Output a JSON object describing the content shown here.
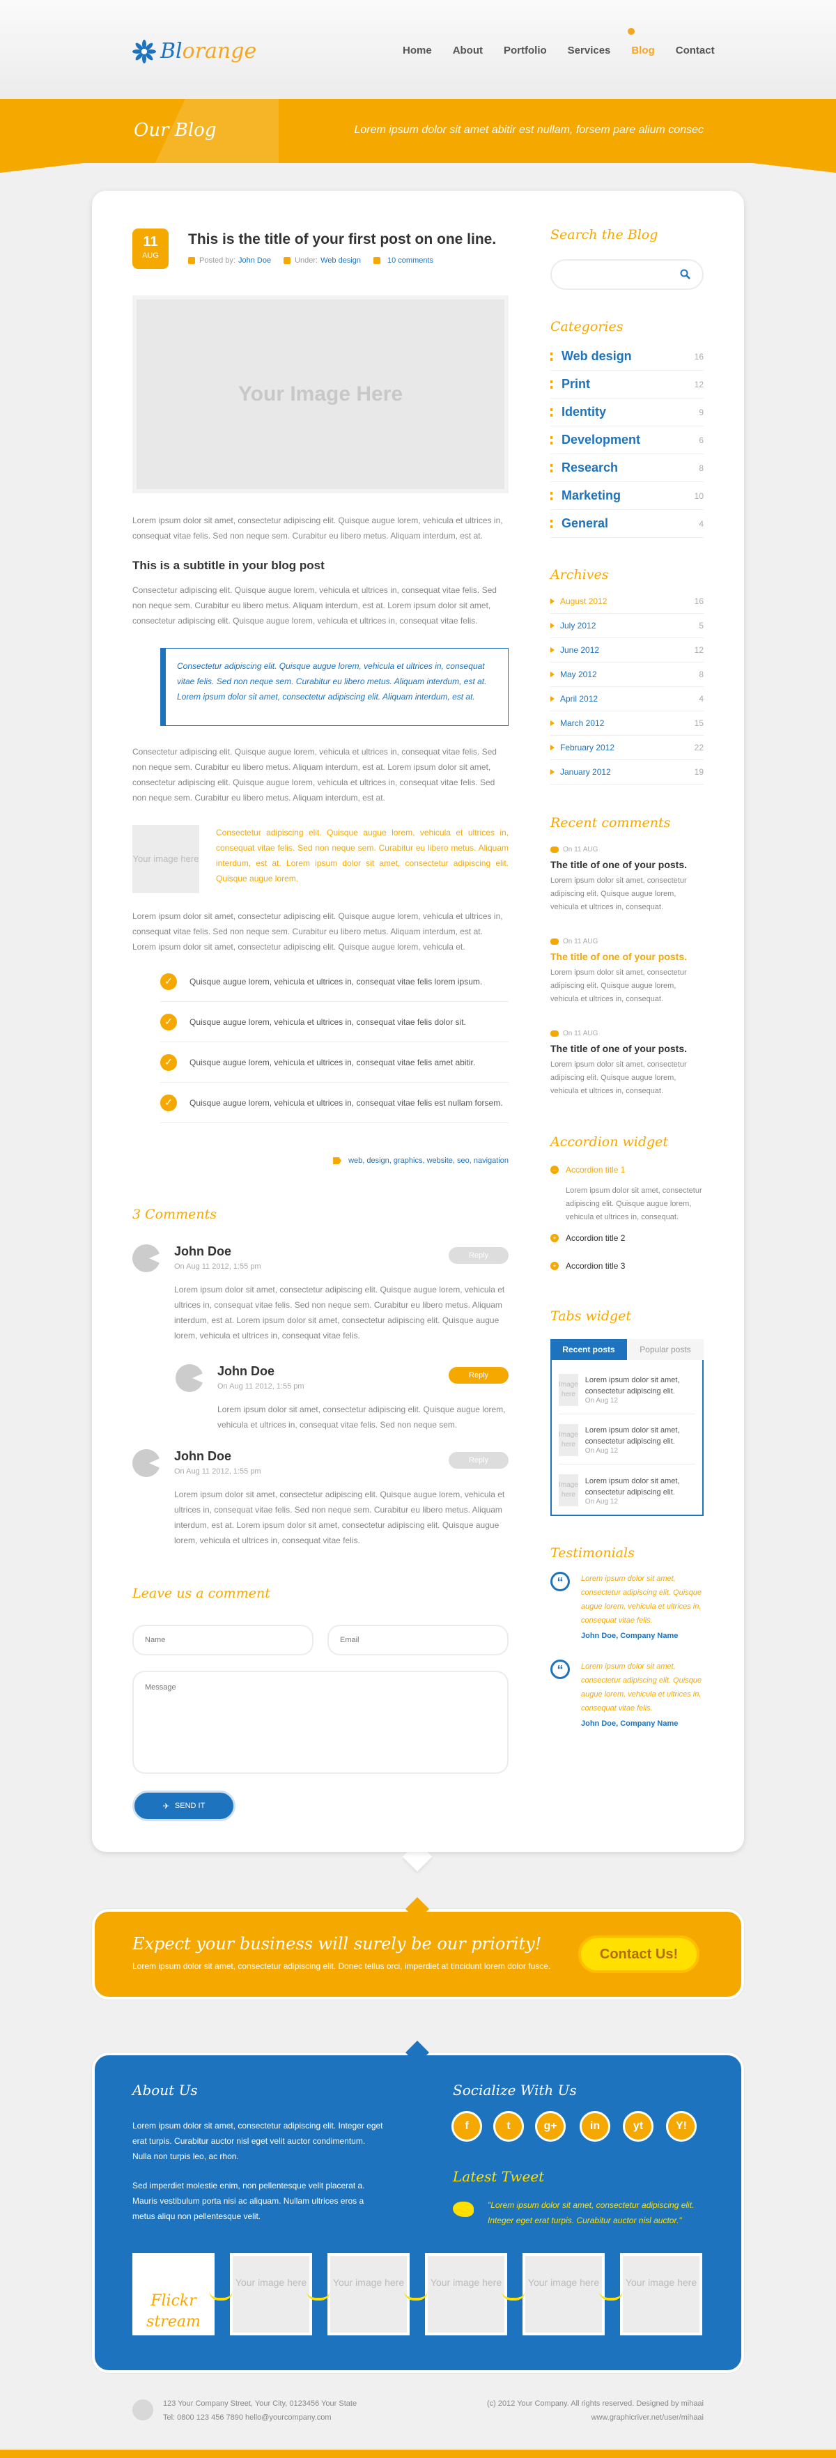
{
  "header": {
    "logo_part1": "Bl",
    "logo_part2": "orange",
    "nav": [
      "Home",
      "About",
      "Portfolio",
      "Services",
      "Blog",
      "Contact"
    ],
    "active_nav": "Blog"
  },
  "banner": {
    "title": "Our Blog",
    "subtitle": "Lorem ipsum dolor sit amet abitir est nullam, forsem pare alium consec"
  },
  "post": {
    "day": "11",
    "month": "AUG",
    "title": "This is the title of your first post on one line.",
    "posted_by_label": "Posted by:",
    "author": "John Doe",
    "under_label": "Under:",
    "category": "Web design",
    "comments": "10 comments",
    "image_label": "Your Image Here",
    "para1": "Lorem ipsum dolor sit amet, consectetur adipiscing elit. Quisque augue lorem, vehicula et ultrices in, consequat vitae felis. Sed non neque sem. Curabitur eu libero metus. Aliquam interdum, est at.",
    "subtitle": "This is a subtitle in your blog post",
    "para2": "Consectetur adipiscing elit. Quisque augue lorem, vehicula et ultrices in, consequat vitae felis. Sed non neque sem. Curabitur eu libero metus. Aliquam interdum, est at. Lorem ipsum dolor sit amet, consectetur adipiscing elit. Quisque augue lorem, vehicula et ultrices in, consequat vitae felis.",
    "quote": "Consectetur adipiscing elit. Quisque augue lorem, vehicula et ultrices in, consequat vitae felis. Sed non neque sem. Curabitur eu libero metus. Aliquam interdum, est at. Lorem ipsum dolor sit amet, consectetur adipiscing elit. Aliquam interdum, est at.",
    "para3": "Consectetur adipiscing elit. Quisque augue lorem, vehicula et ultrices in, consequat vitae felis. Sed non neque sem. Curabitur eu libero metus. Aliquam interdum, est at. Lorem ipsum dolor sit amet, consectetur adipiscing elit. Quisque augue lorem, vehicula et ultrices in, consequat vitae felis. Sed non neque sem. Curabitur eu libero metus. Aliquam interdum, est at.",
    "thumb_label": "Your image here",
    "thumb_text": "Consectetur adipiscing elit. Quisque augue lorem, vehicula et ultrices in, consequat vitae felis. Sed non neque sem. Curabitur eu libero metus. Aliquam interdum, est at. Lorem ipsum dolor sit amet, consectetur adipiscing elit. Quisque augue lorem.",
    "para4": "Lorem ipsum dolor sit amet, consectetur adipiscing elit. Quisque augue lorem, vehicula et ultrices in, consequat vitae felis. Sed non neque sem. Curabitur eu libero metus. Aliquam interdum, est at. Lorem ipsum dolor sit amet, consectetur adipiscing elit. Quisque augue lorem, vehicula et.",
    "checklist": [
      "Quisque augue lorem, vehicula et ultrices in, consequat vitae felis lorem ipsum.",
      "Quisque augue lorem, vehicula et ultrices in, consequat vitae felis dolor sit.",
      "Quisque augue lorem, vehicula et ultrices in, consequat vitae felis amet abitir.",
      "Quisque augue lorem, vehicula et ultrices in, consequat vitae felis est nullam forsem."
    ],
    "tags": "web, design, graphics, website, seo, navigation"
  },
  "comments": {
    "title": "3 Comments",
    "items": [
      {
        "name": "John Doe",
        "date": "On Aug 11 2012, 1:55 pm",
        "reply": "Reply",
        "text": "Lorem ipsum dolor sit amet, consectetur adipiscing elit. Quisque augue lorem, vehicula et ultrices in, consequat vitae felis. Sed non neque sem. Curabitur eu libero metus. Aliquam interdum, est at. Lorem ipsum dolor sit amet, consectetur adipiscing elit. Quisque augue lorem, vehicula et ultrices in, consequat vitae felis."
      },
      {
        "name": "John Doe",
        "date": "On Aug 11 2012, 1:55 pm",
        "reply": "Reply",
        "text": "Lorem ipsum dolor sit amet, consectetur adipiscing elit. Quisque augue lorem, vehicula et ultrices in, consequat vitae felis. Sed non neque sem."
      },
      {
        "name": "John Doe",
        "date": "On Aug 11 2012, 1:55 pm",
        "reply": "Reply",
        "text": "Lorem ipsum dolor sit amet, consectetur adipiscing elit. Quisque augue lorem, vehicula et ultrices in, consequat vitae felis. Sed non neque sem. Curabitur eu libero metus. Aliquam interdum, est at. Lorem ipsum dolor sit amet, consectetur adipiscing elit. Quisque augue lorem, vehicula et ultrices in, consequat vitae felis."
      }
    ]
  },
  "form": {
    "title": "Leave us a comment",
    "name_placeholder": "Name",
    "email_placeholder": "Email",
    "message_placeholder": "Message",
    "send_label": "SEND IT"
  },
  "sidebar": {
    "search_title": "Search the Blog",
    "categories_title": "Categories",
    "categories": [
      {
        "name": "Web design",
        "count": "16"
      },
      {
        "name": "Print",
        "count": "12"
      },
      {
        "name": "Identity",
        "count": "9"
      },
      {
        "name": "Development",
        "count": "6"
      },
      {
        "name": "Research",
        "count": "8"
      },
      {
        "name": "Marketing",
        "count": "10"
      },
      {
        "name": "General",
        "count": "4"
      }
    ],
    "archives_title": "Archives",
    "archives": [
      {
        "name": "August 2012",
        "count": "16"
      },
      {
        "name": "July 2012",
        "count": "5"
      },
      {
        "name": "June 2012",
        "count": "12"
      },
      {
        "name": "May 2012",
        "count": "8"
      },
      {
        "name": "April 2012",
        "count": "4"
      },
      {
        "name": "March 2012",
        "count": "15"
      },
      {
        "name": "February 2012",
        "count": "22"
      },
      {
        "name": "January 2012",
        "count": "19"
      }
    ],
    "recent_title": "Recent comments",
    "recent": [
      {
        "date": "On 11 AUG",
        "title": "The title of one of your posts.",
        "text": "Lorem ipsum dolor sit amet, consectetur adipiscing elit. Quisque augue lorem, vehicula et ultrices in, consequat."
      },
      {
        "date": "On 11 AUG",
        "title": "The title of one of your posts.",
        "text": "Lorem ipsum dolor sit amet, consectetur adipiscing elit. Quisque augue lorem, vehicula et ultrices in, consequat."
      },
      {
        "date": "On 11 AUG",
        "title": "The title of one of your posts.",
        "text": "Lorem ipsum dolor sit amet, consectetur adipiscing elit. Quisque augue lorem, vehicula et ultrices in, consequat."
      }
    ],
    "accordion_title": "Accordion widget",
    "accordion": [
      "Accordion title 1",
      "Accordion title 2",
      "Accordion title 3"
    ],
    "accordion_body": "Lorem ipsum dolor sit amet, consectetur adipiscing elit. Quisque augue lorem, vehicula et ultrices in, consequat.",
    "tabs_title": "Tabs widget",
    "tabs": [
      "Recent posts",
      "Popular posts"
    ],
    "tab_posts": [
      {
        "thumb": "Image here",
        "text": "Lorem ipsum dolor sit amet, consectetur adipiscing elit.",
        "date": "On Aug 12"
      },
      {
        "thumb": "Image here",
        "text": "Lorem ipsum dolor sit amet, consectetur adipiscing elit.",
        "date": "On Aug 12"
      },
      {
        "thumb": "Image here",
        "text": "Lorem ipsum dolor sit amet, consectetur adipiscing elit.",
        "date": "On Aug 12"
      }
    ],
    "testimonials_title": "Testimonials",
    "testimonials": [
      {
        "text": "Lorem ipsum dolor sit amet, consectetur adipiscing elit. Quisque augue lorem, vehicula et ultrices in, consequat vitae felis.",
        "author": "John Doe, Company Name"
      },
      {
        "text": "Lorem ipsum dolor sit amet, consectetur adipiscing elit. Quisque augue lorem, vehicula et ultrices in, consequat vitae felis.",
        "author": "John Doe, Company Name"
      }
    ]
  },
  "cta": {
    "title": "Expect your business will surely be our priority!",
    "subtitle": "Lorem ipsum dolor sit amet, consectetur adipiscing elit. Donec tellus orci, imperdiet at tincidunt lorem dolor fusce.",
    "button": "Contact Us!"
  },
  "footer": {
    "about_title": "About Us",
    "about_text1": "Lorem ipsum dolor sit amet, consectetur adipiscing elit. Integer eget erat turpis. Curabitur auctor nisl eget velit auctor condimentum. Nulla non turpis leo, ac rhon.",
    "about_text2": "Sed imperdiet molestie enim, non pellentesque velit placerat a. Mauris vestibulum porta nisi ac aliquam. Nullam ultrices eros a metus aliqu non pellentesque velit.",
    "social_title": "Socialize With Us",
    "social": [
      "f",
      "t",
      "g+",
      "in",
      "yt",
      "Y!"
    ],
    "tweet_title": "Latest Tweet",
    "tweet": "\"Lorem ipsum dolor sit amet, consectetur adipiscing elit. Integer eget erat turpis. Curabitur auctor nisl auctor.\"",
    "flickr_label": "Flickr stream",
    "flickr_placeholder": "Your image here"
  },
  "bottom": {
    "address": "123 Your Company Street, Your City, 0123456 Your State",
    "contact": "Tel: 0800 123 456 7890      hello@yourcompany.com",
    "copyright": "(c) 2012 Your Company. All rights reserved. Designed by mihaai",
    "credit": "www.graphicriver.net/user/mihaai"
  },
  "colors": {
    "orange": "#f5a800",
    "blue": "#1e73be"
  }
}
